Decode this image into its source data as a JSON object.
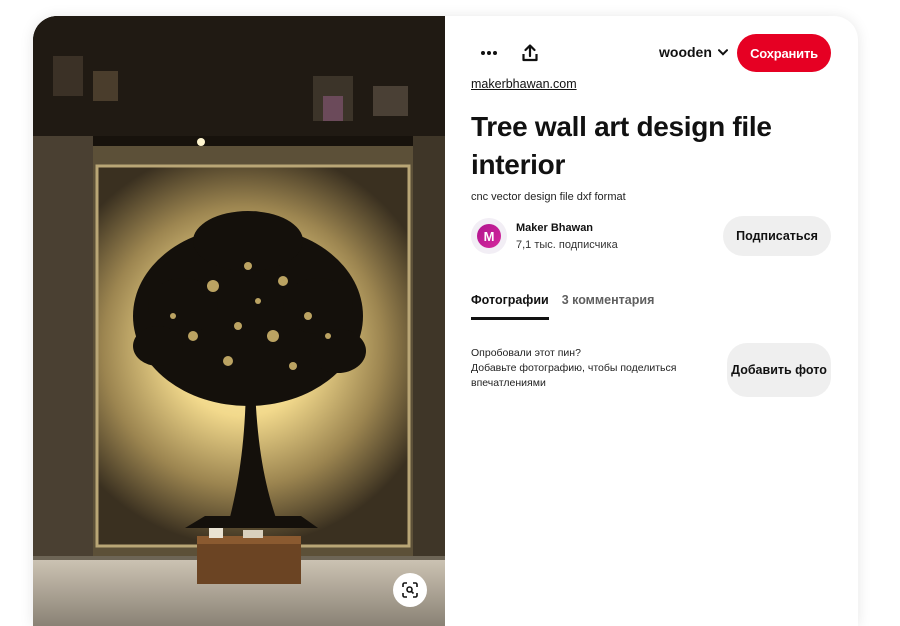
{
  "pin": {
    "source_link": "makerbhawan.com",
    "title": "Tree wall art design file interior",
    "description": "cnc vector design file dxf format"
  },
  "toolbar": {
    "more_icon": "ellipsis-icon",
    "share_icon": "share-upload-icon",
    "board_name": "wooden",
    "board_chevron_icon": "chevron-down-icon",
    "save_label": "Сохранить"
  },
  "author": {
    "avatar_letter": "M",
    "name": "Maker Bhawan",
    "followers": "7,1 тыс. подписчика",
    "follow_label": "Подписаться"
  },
  "tabs": [
    {
      "label": "Фотографии",
      "active": true
    },
    {
      "label": "3 комментария",
      "active": false
    }
  ],
  "tried": {
    "line1": "Опробовали этот пин?",
    "line2": "Добавьте фотографию, чтобы поделиться впечатлениями",
    "add_photo_label": "Добавить фото"
  },
  "image": {
    "lens_icon": "visual-search-icon"
  },
  "colors": {
    "save": "#e60023",
    "secondary_button": "#efefef",
    "text": "#111111"
  }
}
